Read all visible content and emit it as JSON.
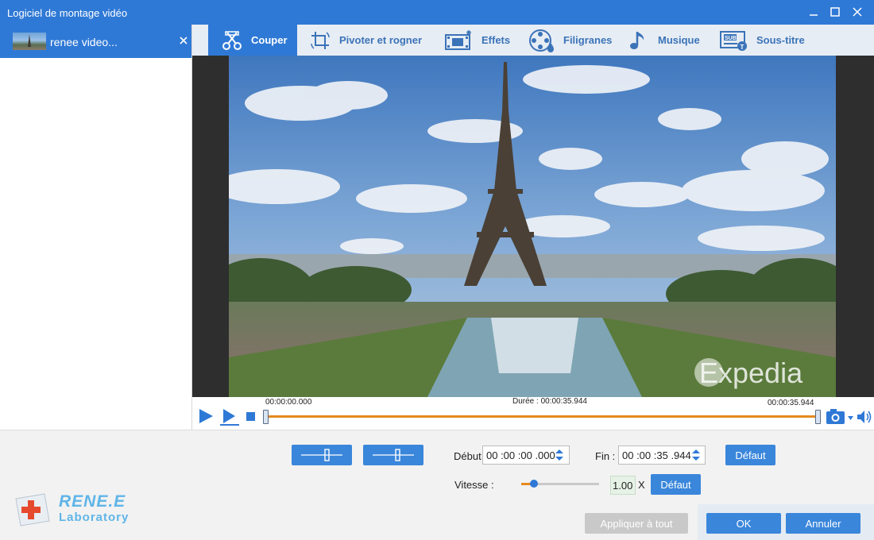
{
  "window": {
    "title": "Logiciel de montage vidéo"
  },
  "file_list": {
    "items": [
      {
        "name": "renee video..."
      }
    ]
  },
  "tabs": [
    {
      "label": "Couper",
      "icon": "cut-icon"
    },
    {
      "label": "Pivoter et rogner",
      "icon": "crop-rotate-icon"
    },
    {
      "label": "Effets",
      "icon": "effects-icon"
    },
    {
      "label": "Filigranes",
      "icon": "watermark-icon"
    },
    {
      "label": "Musique",
      "icon": "music-note-icon"
    },
    {
      "label": "Sous-titre",
      "icon": "subtitle-icon"
    }
  ],
  "preview": {
    "watermark": "Expedia"
  },
  "timeline": {
    "start_time": "00:00:00.000",
    "duration_label": "Durée : 00:00:35.944",
    "end_time": "00:00:35.944"
  },
  "trim": {
    "start_label": "Début",
    "start_value": "00 :00 :00 .000",
    "end_label": "Fin :",
    "end_value": "00 :00 :35 .944",
    "default_button": "Défaut"
  },
  "speed": {
    "label": "Vitesse :",
    "value": "1.00",
    "unit": "X",
    "level_fraction": 0.16,
    "default_button": "Défaut"
  },
  "actions": {
    "apply_all": "Appliquer à tout",
    "ok": "OK",
    "cancel": "Annuler"
  },
  "logo": {
    "line1": "RENE.E",
    "line2": "Laboratory"
  },
  "colors": {
    "accent": "#2f79d6",
    "progress": "#e58a1f",
    "tab_text": "#3b73b8"
  }
}
